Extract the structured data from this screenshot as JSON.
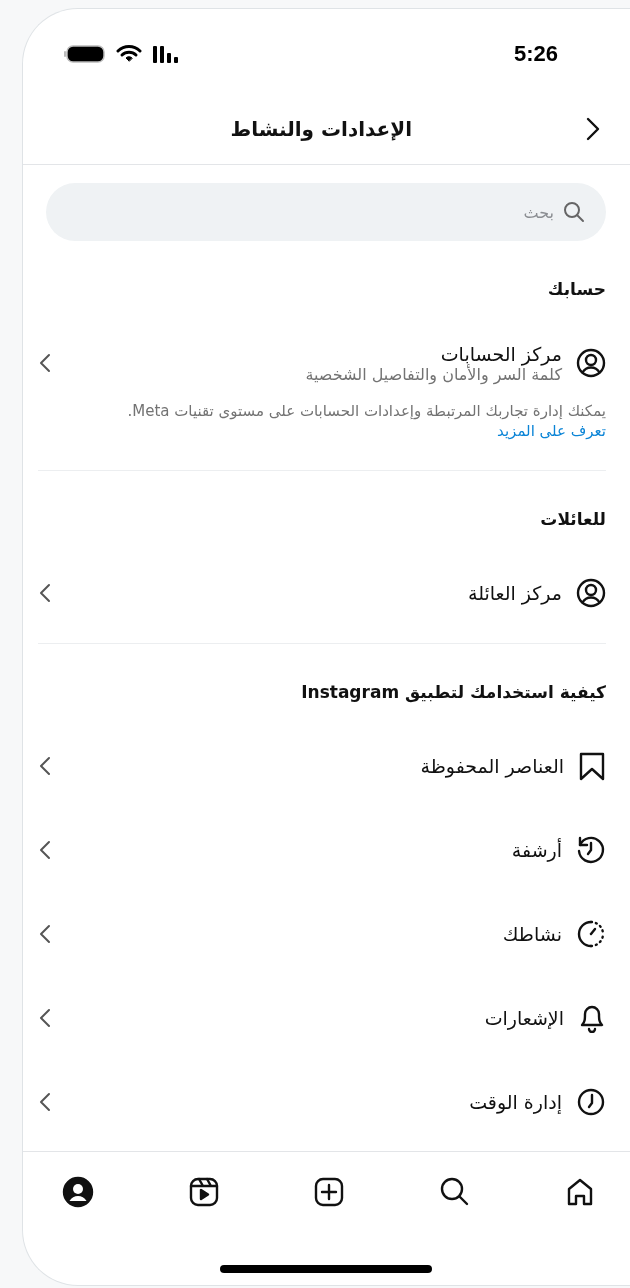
{
  "status_bar": {
    "time": "5:26"
  },
  "header": {
    "title": "الإعدادات والنشاط"
  },
  "search": {
    "placeholder": "بحث"
  },
  "sections": [
    {
      "heading": "حسابك",
      "items": [
        {
          "kind": "account",
          "label": "مركز الحسابات",
          "subtitle": "كلمة السر والأمان والتفاصيل الشخصية"
        }
      ],
      "note": {
        "text": "يمكنك إدارة تجاربك المرتبطة وإعدادات الحسابات على مستوى تقنيات Meta.",
        "link": "تعرف على المزيد"
      }
    },
    {
      "heading": "للعائلات",
      "items": [
        {
          "kind": "account",
          "label": "مركز العائلة"
        }
      ]
    },
    {
      "heading": "كيفية استخدامك لتطبيق Instagram",
      "items": [
        {
          "kind": "saved",
          "label": "العناصر المحفوظة"
        },
        {
          "kind": "archive",
          "label": "أرشفة"
        },
        {
          "kind": "activity",
          "label": "نشاطك"
        },
        {
          "kind": "notifications",
          "label": "الإشعارات"
        },
        {
          "kind": "time",
          "label": "إدارة الوقت"
        }
      ]
    }
  ],
  "tab_bar": [
    {
      "kind": "home",
      "selected": false
    },
    {
      "kind": "search",
      "selected": false
    },
    {
      "kind": "create",
      "selected": false
    },
    {
      "kind": "reels",
      "selected": false
    },
    {
      "kind": "profile",
      "selected": true
    }
  ]
}
